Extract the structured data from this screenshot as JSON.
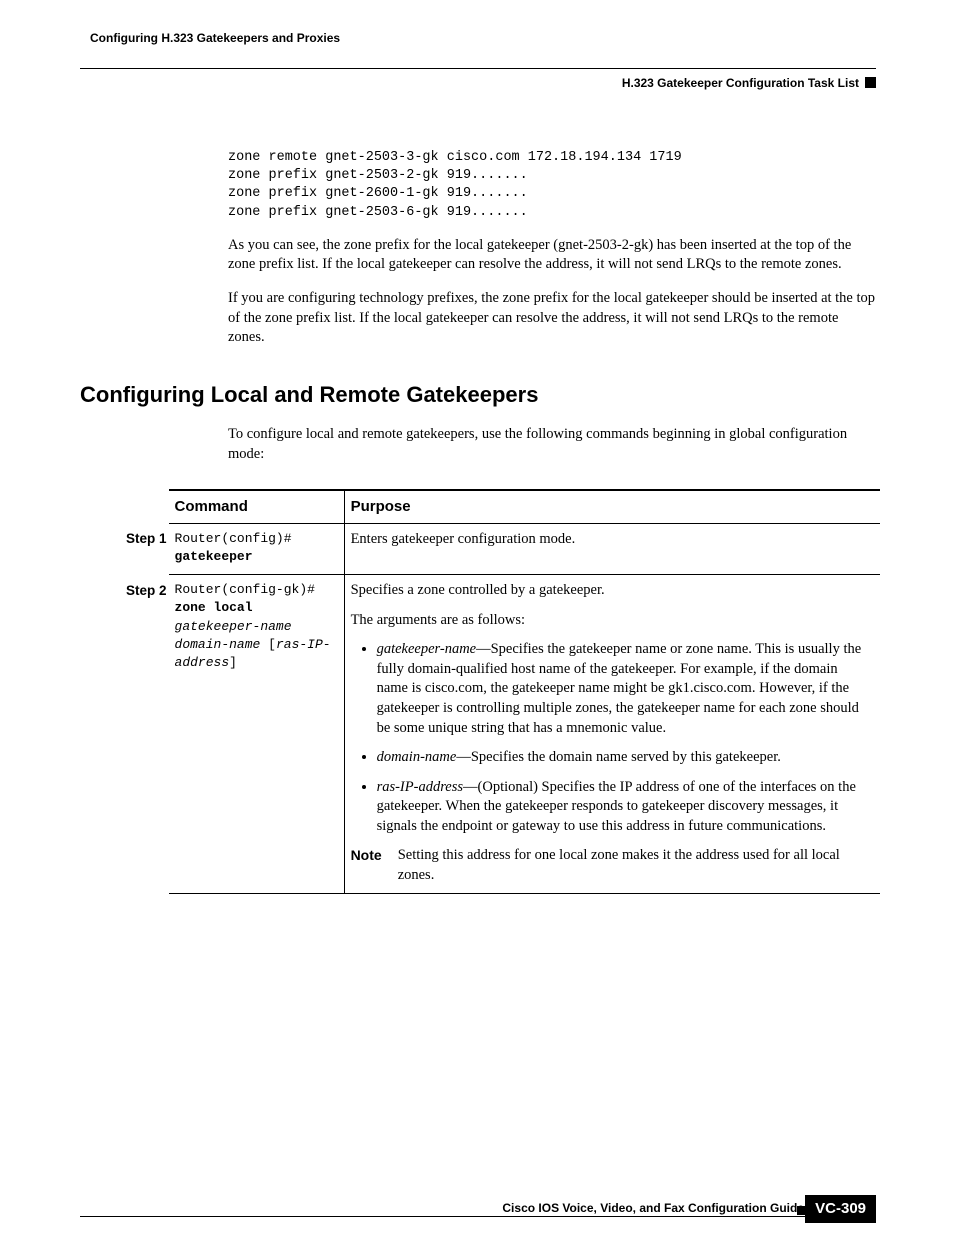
{
  "header": {
    "chapter": "Configuring H.323 Gatekeepers and Proxies",
    "section": "H.323 Gatekeeper Configuration Task List"
  },
  "code": "zone remote gnet-2503-3-gk cisco.com 172.18.194.134 1719\nzone prefix gnet-2503-2-gk 919.......\nzone prefix gnet-2600-1-gk 919.......\nzone prefix gnet-2503-6-gk 919.......",
  "paras": {
    "p1": "As you can see, the zone prefix for the local gatekeeper (gnet-2503-2-gk) has been inserted at the top of the zone prefix list. If the local gatekeeper can resolve the address, it will not send LRQs to the remote zones.",
    "p2": "If you are configuring technology prefixes, the zone prefix for the local gatekeeper should be inserted at the top of the zone prefix list. If the local gatekeeper can resolve the address, it will not send LRQs to the remote zones."
  },
  "heading": "Configuring Local and Remote Gatekeepers",
  "intro": "To configure local and remote gatekeepers, use the following commands beginning in global configuration mode:",
  "table": {
    "head": {
      "command": "Command",
      "purpose": "Purpose"
    },
    "steps": [
      {
        "label": "Step 1",
        "cmd": {
          "prompt": "Router(config)# ",
          "kw": "gatekeeper",
          "arg1": "",
          "arg2": ""
        },
        "purpose_simple": "Enters gatekeeper configuration mode."
      },
      {
        "label": "Step 2",
        "cmd": {
          "prompt": "Router(config-gk)# ",
          "kw": "zone local",
          "arg1": "gatekeeper-name",
          "arg2": "domain-name",
          "opt": "[",
          "arg3": "ras-IP-address",
          "opt2": "]"
        },
        "purpose": {
          "lead": "Specifies a zone controlled by a gatekeeper.",
          "args_intro": "The arguments are as follows:",
          "bullets": [
            {
              "term": "gatekeeper-name",
              "desc": "—Specifies the gatekeeper name or zone name. This is usually the fully domain-qualified host name of the gatekeeper. For example, if the domain name is cisco.com, the gatekeeper name might be gk1.cisco.com. However, if the gatekeeper is controlling multiple zones, the gatekeeper name for each zone should be some unique string that has a mnemonic value."
            },
            {
              "term": "domain-name",
              "desc": "—Specifies the domain name served by this gatekeeper."
            },
            {
              "term": "ras-IP-address",
              "desc": "—(Optional) Specifies the IP address of one of the interfaces on the gatekeeper. When the gatekeeper responds to gatekeeper discovery messages, it signals the endpoint or gateway to use this address in future communications."
            }
          ],
          "note_label": "Note",
          "note": "Setting this address for one local zone makes it the address used for all local zones."
        }
      }
    ]
  },
  "footer": {
    "guide": "Cisco IOS Voice, Video, and Fax Configuration Guide",
    "page": "VC-309"
  }
}
